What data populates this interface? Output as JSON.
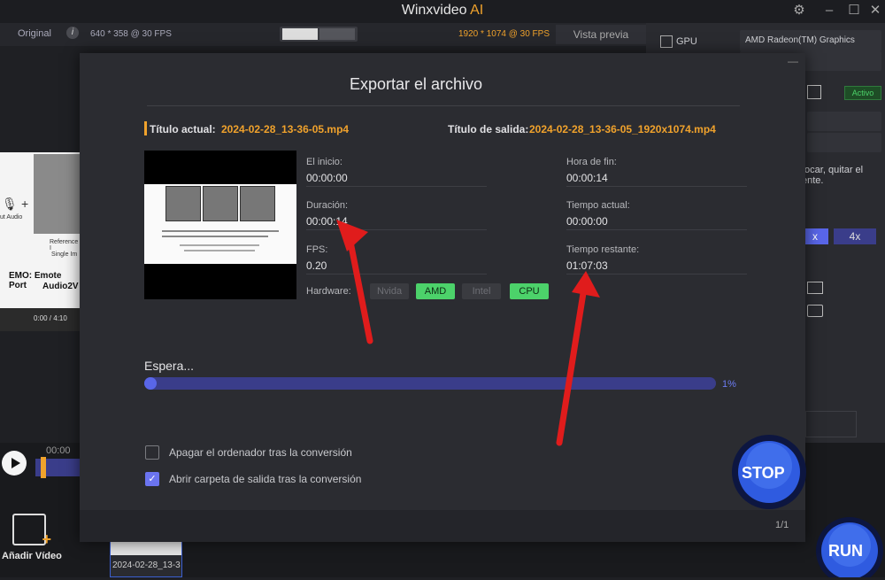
{
  "window": {
    "title_main": "Winxvideo",
    "title_ai": "AI"
  },
  "topbar": {
    "original_label": "Original",
    "original_info": "640 * 358 @ 30 FPS",
    "output_info": "1920 * 1074 @ 30 FPS",
    "preview_label": "Vista previa"
  },
  "right_panel": {
    "gpu_label": "GPU",
    "gpu_device": "AMD Radeon(TM) Graphics",
    "active_badge": "Activo",
    "desc_line1": "focar, quitar el",
    "desc_line2": "ente.",
    "scale_x": "x",
    "scale_4x": "4x"
  },
  "left_preview": {
    "audio_label": "ut Audio",
    "ref_label": "Reference I",
    "single_label": "Single Im",
    "headline1": "EMO: Emote Port",
    "headline2": "Audio2V",
    "time_label": "0:00 / 4:10",
    "bottom_time": "00:00"
  },
  "bottom": {
    "add_video_label": "Añadir Vídeo",
    "file_thumb_label": "2024-02-28_13-3",
    "run_label": "RUN"
  },
  "modal": {
    "title": "Exportar el archivo",
    "current_title_label": "Título actual:",
    "current_file": "2024-02-28_13-36-05.mp4",
    "output_title_label": "Título de salida:",
    "output_file": "2024-02-28_13-36-05_1920x1074.mp4",
    "fields": {
      "start_label": "El inicio:",
      "start_value": "00:00:00",
      "end_label": "Hora de fin:",
      "end_value": "00:00:14",
      "duration_label": "Duración:",
      "duration_value": "00:00:14",
      "current_time_label": "Tiempo actual:",
      "current_time_value": "00:00:00",
      "fps_label": "FPS:",
      "fps_value": "0.20",
      "remaining_label": "Tiempo restante:",
      "remaining_value": "01:07:03"
    },
    "hardware": {
      "label": "Hardware:",
      "options": [
        {
          "name": "Nvida",
          "active": false
        },
        {
          "name": "AMD",
          "active": true
        },
        {
          "name": "Intel",
          "active": false
        },
        {
          "name": "CPU",
          "active": true
        }
      ]
    },
    "progress": {
      "status_label": "Espera...",
      "percent_label": "1%",
      "fraction": 0.01
    },
    "options": {
      "shutdown_label": "Apagar el ordenador tras la conversión",
      "shutdown_checked": false,
      "open_folder_label": "Abrir carpeta de salida tras la conversión",
      "open_folder_checked": true
    },
    "stop_label": "STOP",
    "page_count": "1/1"
  },
  "colors": {
    "accent_orange": "#f0a22c",
    "hardware_active": "#4cd26a",
    "progress_blue": "#5966e8",
    "annotation_red": "#e01c1c"
  }
}
